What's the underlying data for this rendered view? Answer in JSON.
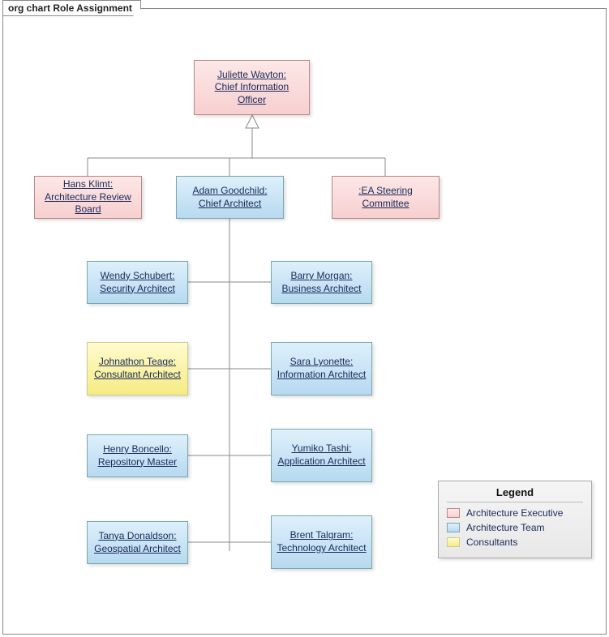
{
  "frame_title": "org chart Role Assignment",
  "nodes": {
    "cio": {
      "name": "Juliette Wayton",
      "role": "Chief Information Officer",
      "category": "exec"
    },
    "arb": {
      "name": "Hans Klimt",
      "role": "Architecture Review Board",
      "category": "exec"
    },
    "ca": {
      "name": "Adam Goodchild",
      "role": "Chief Architect",
      "category": "team"
    },
    "easc": {
      "name": "",
      "role": "EA Steering Committee",
      "category": "exec"
    },
    "sec": {
      "name": "Wendy Schubert",
      "role": "Security Architect",
      "category": "team"
    },
    "bus": {
      "name": "Barry Morgan",
      "role": "Business Architect",
      "category": "team"
    },
    "cons": {
      "name": "Johnathon Teage",
      "role": "Consultant Architect",
      "category": "cons"
    },
    "info": {
      "name": "Sara Lyonette",
      "role": "Information Architect",
      "category": "team"
    },
    "repo": {
      "name": "Henry Boncello",
      "role": "Repository Master",
      "category": "team"
    },
    "app": {
      "name": "Yumiko Tashi",
      "role": "Application Architect",
      "category": "team"
    },
    "geo": {
      "name": "Tanya Donaldson",
      "role": "Geospatial Architect",
      "category": "team"
    },
    "tech": {
      "name": "Brent Talgram",
      "role": "Technology Architect",
      "category": "team"
    }
  },
  "legend": {
    "title": "Legend",
    "items": [
      {
        "label": "Architecture Executive",
        "category": "exec"
      },
      {
        "label": "Architecture Team",
        "category": "team"
      },
      {
        "label": "Consultants",
        "category": "cons"
      }
    ]
  },
  "colors": {
    "exec": "#f7cfcf",
    "team": "#b7d9f0",
    "cons": "#f5eb84"
  }
}
